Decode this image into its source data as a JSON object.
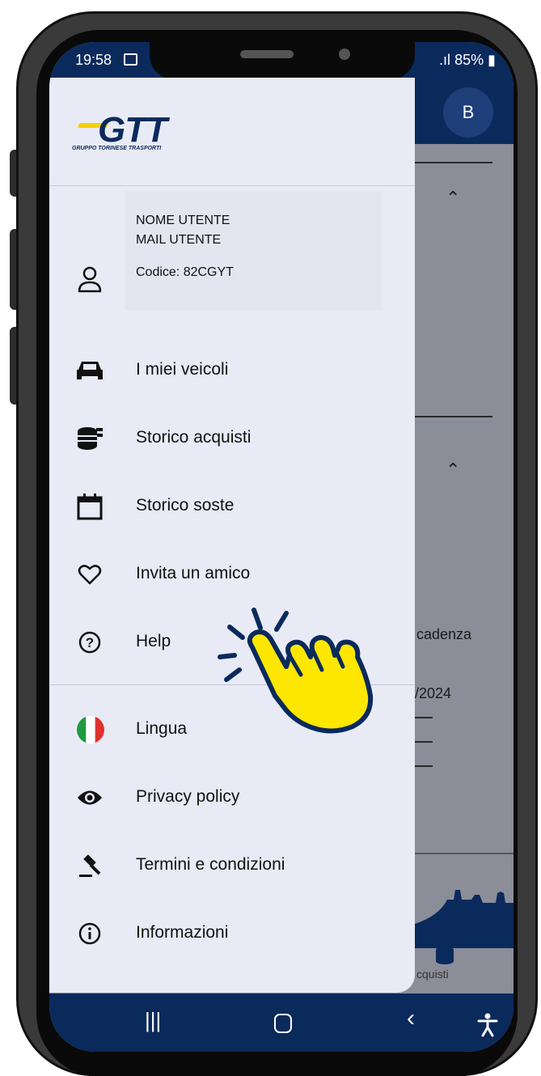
{
  "status_bar": {
    "time": "19:58",
    "battery": "85%",
    "signal_text": ".ıl"
  },
  "app_bar": {
    "avatar_initial": "B"
  },
  "background_fragments": {
    "scadenza": "cadenza",
    "date": "/2024",
    "acquisti": "cquisti"
  },
  "drawer": {
    "logo_text": "GTT",
    "logo_subtitle": "GRUPPO TORINESE TRASPORTI",
    "user": {
      "name": "NOME UTENTE",
      "mail": "MAIL UTENTE",
      "code": "Codice:  82CGYT"
    },
    "menu": [
      {
        "label": "I miei veicoli",
        "icon": "car-icon"
      },
      {
        "label": "Storico acquisti",
        "icon": "coins-icon"
      },
      {
        "label": "Storico soste",
        "icon": "calendar-icon"
      },
      {
        "label": "Invita un amico",
        "icon": "heart-icon"
      },
      {
        "label": "Help",
        "icon": "help-icon"
      }
    ],
    "secondary_menu": [
      {
        "label": "Lingua",
        "icon": "italian-flag-icon"
      },
      {
        "label": "Privacy policy",
        "icon": "eye-icon"
      },
      {
        "label": "Termini e condizioni",
        "icon": "gavel-icon"
      },
      {
        "label": "Informazioni",
        "icon": "info-icon"
      }
    ]
  },
  "colors": {
    "brand_navy": "#0b2a5c",
    "drawer_bg": "#e8ebf5",
    "pointer_yellow": "#fde600"
  }
}
